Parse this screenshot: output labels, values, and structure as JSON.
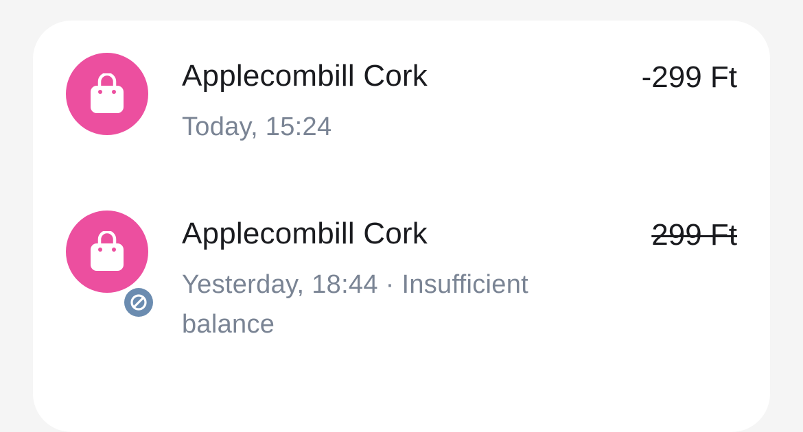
{
  "colors": {
    "page_background": "#f5f5f5",
    "card_background": "#ffffff",
    "avatar_pink": "#ec4f9f",
    "declined_badge": "#6b8cb0",
    "primary_text": "#1a1b1f",
    "secondary_text": "#7a8494"
  },
  "transactions": [
    {
      "merchant": "Applecombill Cork",
      "meta": "Today, 15:24",
      "amount": "-299 Ft",
      "icon": "shopping-bag-icon",
      "declined": false
    },
    {
      "merchant": "Applecombill Cork",
      "meta": "Yesterday, 18:44 · Insufficient balance",
      "amount": "299 Ft",
      "icon": "shopping-bag-icon",
      "status_icon": "blocked-icon",
      "declined": true
    }
  ]
}
